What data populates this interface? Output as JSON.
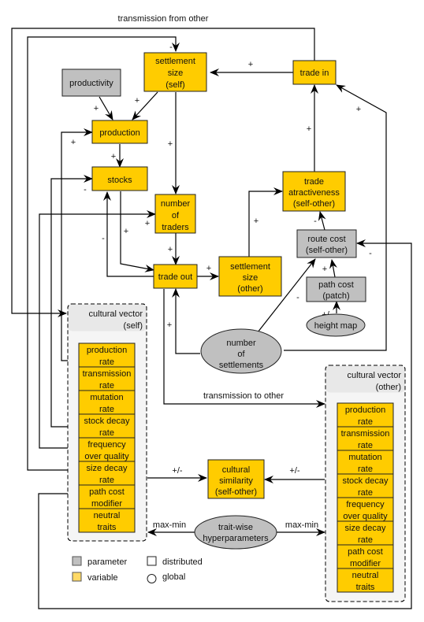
{
  "colors": {
    "variable": "#FFCC00",
    "parameter": "#C0C0C0",
    "group_background": "#F5F5F5",
    "line": "#000000"
  },
  "nodes": {
    "settlement_size_self": [
      "settlement",
      "size",
      "(self)"
    ],
    "trade_in": [
      "trade in"
    ],
    "productivity": [
      "productivity"
    ],
    "production": [
      "production"
    ],
    "stocks": [
      "stocks"
    ],
    "number_of_traders": [
      "number",
      "of",
      "traders"
    ],
    "trade_out": [
      "trade out"
    ],
    "settlement_size_other": [
      "settlement",
      "size",
      "(other)"
    ],
    "trade_attractiveness": [
      "trade",
      "atractiveness",
      "(self-other)"
    ],
    "route_cost": [
      "route cost",
      "(self-other)"
    ],
    "path_cost": [
      "path cost",
      "(patch)"
    ],
    "height_map": [
      "height map"
    ],
    "number_of_settlements": [
      "number",
      "of",
      "settlements"
    ],
    "cultural_similarity": [
      "cultural",
      "similarity",
      "(self-other)"
    ],
    "trait_wise_hyperparameters": [
      "trait-wise",
      "hyperparameters"
    ]
  },
  "groups": {
    "cultural_vector_self": {
      "title": [
        "cultural vector",
        "(self)"
      ],
      "traits": [
        [
          "production",
          "rate"
        ],
        [
          "transmission",
          "rate"
        ],
        [
          "mutation",
          "rate"
        ],
        [
          "stock decay",
          "rate"
        ],
        [
          "frequency",
          "over quality"
        ],
        [
          "size decay",
          "rate"
        ],
        [
          "path cost",
          "modifier"
        ],
        [
          "neutral",
          "traits"
        ]
      ]
    },
    "cultural_vector_other": {
      "title": [
        "cultural vector",
        "(other)"
      ],
      "traits": [
        [
          "production",
          "rate"
        ],
        [
          "transmission",
          "rate"
        ],
        [
          "mutation",
          "rate"
        ],
        [
          "stock decay",
          "rate"
        ],
        [
          "frequency",
          "over quality"
        ],
        [
          "size decay",
          "rate"
        ],
        [
          "path cost",
          "modifier"
        ],
        [
          "neutral",
          "traits"
        ]
      ]
    }
  },
  "edge_labels": {
    "transmission_from_other": "transmission from other",
    "transmission_to_other": "transmission to other",
    "trade_in_to_size": "+",
    "size_to_production": "+",
    "productivity_to_production": "+",
    "production_rate_to_production": "+",
    "production_to_stocks": "+",
    "stock_decay_to_stocks": "-",
    "size_to_traders": "+",
    "freq_to_traders": "+",
    "traders_to_trade_out": "+",
    "stocks_to_trade_out": "+",
    "trade_out_to_stocks": "-",
    "trade_out_to_size_other": "+",
    "size_other_to_attractiveness": "+",
    "attractiveness_to_trade_in": "+",
    "route_cost_to_attractiveness": "-",
    "settlements_to_trade_in": "+",
    "settlements_to_trade_out": "+",
    "settlements_to_route_cost": "-",
    "path_cost_to_route_cost": "+",
    "height_map_to_path_cost": "+/-",
    "path_cost_modifier_to_route_cost": "-",
    "size_decay_to_size": "-",
    "self_to_similarity": "+/-",
    "other_to_similarity": "+/-",
    "hyper_to_self": "max-min",
    "hyper_to_other": "max-min"
  },
  "legend": {
    "parameter": "parameter",
    "variable": "variable",
    "distributed": "distributed",
    "global": "global"
  }
}
